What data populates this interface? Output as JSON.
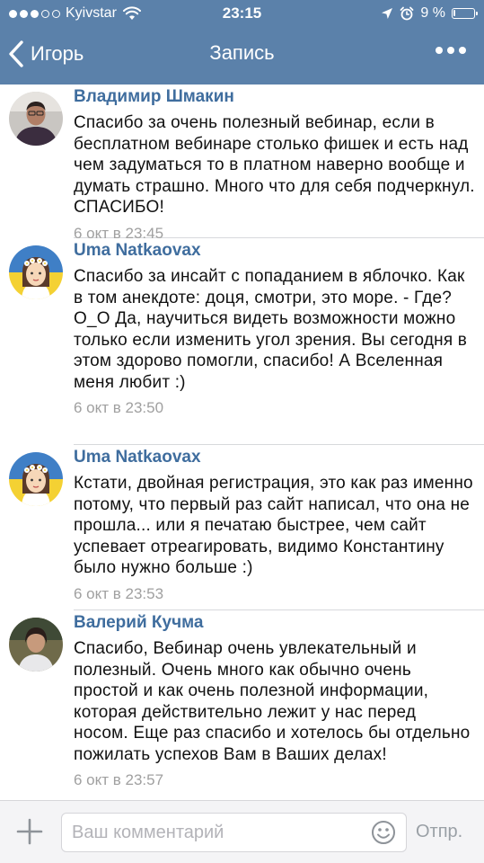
{
  "status_bar": {
    "carrier": "Kyivstar",
    "time": "23:15",
    "battery_percent": "9 %",
    "battery_level": 0.09,
    "signal_bars": 3,
    "signal_total": 5
  },
  "nav": {
    "back_label": "Игорь",
    "title": "Запись"
  },
  "comments": [
    {
      "author": "Владимир Шмакин",
      "text": "Спасибо за очень полезный вебинар, если в бесплатном вебинаре столько фишек и есть над чем задуматься то в платном наверно вообще и думать страшно. Много что для себя подчеркнул. СПАСИБО!",
      "date": "6 окт в 23:45"
    },
    {
      "author": "Uma Natkaovax",
      "text": "Спасибо за инсайт с попаданием в яблочко. Как в том анекдоте: доця, смотри, это море. - Где? О_О Да, научиться видеть возможности можно только если изменить угол зрения. Вы сегодня в этом здорово помогли, спасибо! А Вселенная меня любит :)",
      "date": "6 окт в 23:50"
    },
    {
      "author": "Uma Natkaovax",
      "text": "Кстати, двойная регистрация, это как раз именно потому, что первый раз сайт написал, что она не прошла... или я печатаю быстрее, чем сайт успевает отреагировать, видимо Константину было нужно больше :)",
      "date": "6 окт в 23:53"
    },
    {
      "author": "Валерий Кучма",
      "text": "Спасибо, Вебинар очень увлекательный и полезный. Очень много как обычно очень простой и как очень полезной информации, которая действительно лежит у нас перед носом. Еще раз спасибо и хотелось бы отдельно пожилать успехов Вам в Ваших делах!",
      "date": "6 окт в 23:57"
    }
  ],
  "composer": {
    "placeholder": "Ваш комментарий",
    "value": "",
    "send_label": "Отпр."
  },
  "colors": {
    "header_bg": "#5b81aa",
    "author": "#3f6d9e",
    "date": "#a0a0a0"
  },
  "icons": {
    "wifi": "wifi-icon",
    "location": "location-arrow-icon",
    "alarm": "alarm-clock-icon",
    "battery": "battery-icon",
    "back": "chevron-left-icon",
    "more": "ellipsis-icon",
    "attach": "plus-icon",
    "emoji": "smiley-icon"
  }
}
